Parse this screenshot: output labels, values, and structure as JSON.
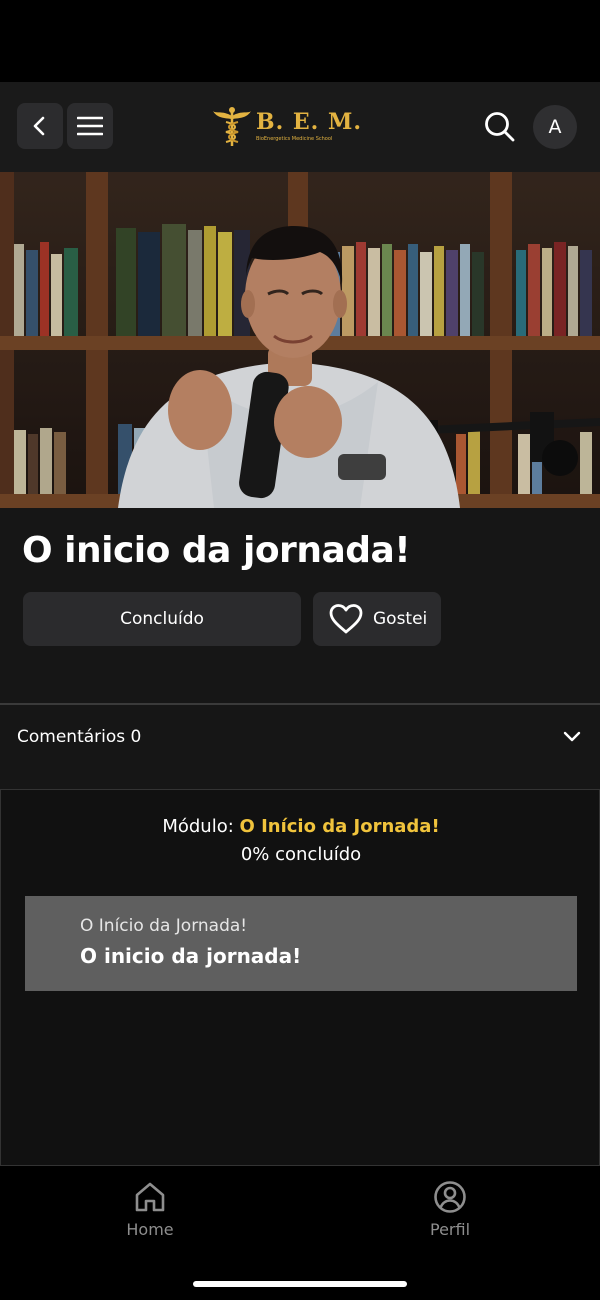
{
  "header": {
    "logo_text": "B. E. M.",
    "logo_subtitle": "BioEnergetics Medicine School",
    "avatar_initial": "A",
    "brand_color": "#e3b341"
  },
  "lesson": {
    "title": "O inicio da jornada!",
    "done_label": "Concluído",
    "like_label": "Gostei"
  },
  "comments": {
    "label": "Comentários 0"
  },
  "module": {
    "prefix": "Módulo: ",
    "name": "O Início da Jornada!",
    "progress": "0% concluído",
    "accent_color": "#f0c33c",
    "lessons": [
      {
        "module": "O Início da Jornada!",
        "title": "O inicio da jornada!"
      }
    ]
  },
  "bottom_nav": {
    "items": [
      {
        "label": "Home",
        "icon": "home-icon"
      },
      {
        "label": "Perfil",
        "icon": "user-circle-icon"
      }
    ]
  }
}
